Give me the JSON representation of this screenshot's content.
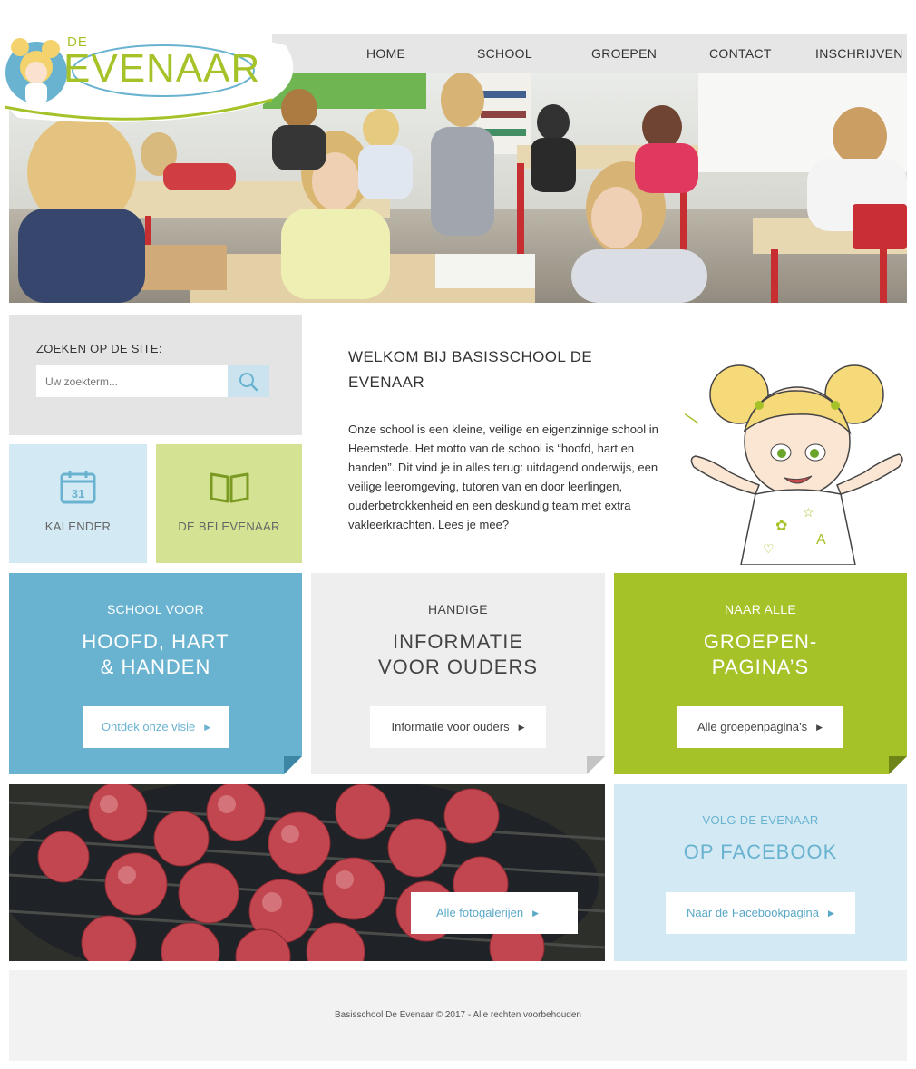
{
  "brand": {
    "logo_small": "DE",
    "logo_big": "EVENAAR"
  },
  "nav": {
    "items": [
      {
        "label": "HOME"
      },
      {
        "label": "SCHOOL"
      },
      {
        "label": "GROEPEN"
      },
      {
        "label": "CONTACT"
      },
      {
        "label": "INSCHRIJVEN"
      }
    ]
  },
  "search": {
    "label": "ZOEKEN OP DE SITE:",
    "placeholder": "Uw zoekterm..."
  },
  "tiles": {
    "calendar": {
      "label": "KALENDER",
      "icon": "calendar-icon",
      "day": "31"
    },
    "belevenaar": {
      "label": "DE BELEVENAAR",
      "icon": "open-book-icon"
    }
  },
  "welcome": {
    "title": "WELKOM BIJ BASISSCHOOL DE EVENAAR",
    "text": "Onze school is een kleine, veilige en eigenzinnige school in Heemstede. Het motto van de school is “hoofd, hart en handen”. Dit vind je in alles terug: uitdagend onderwijs, een veilige leeromgeving, tutoren van en door leerlingen, ouderbetrokkenheid en een deskundig team met extra vakleerkrachten. Lees je mee?"
  },
  "features": {
    "vision": {
      "sub": "SCHOOL VOOR",
      "title": "HOOFD, HART\n& HANDEN",
      "button": "Ontdek onze visie"
    },
    "parents": {
      "sub": "HANDIGE",
      "title": "INFORMATIE\nVOOR OUDERS",
      "button": "Informatie voor ouders"
    },
    "groups": {
      "sub": "NAAR ALLE",
      "title": "GROEPEN-\nPAGINA’S",
      "button": "Alle groepenpagina’s"
    }
  },
  "gallery": {
    "button": "Alle fotogalerijen"
  },
  "facebook": {
    "sub": "VOLG DE EVENAAR",
    "title": "OP FACEBOOK",
    "button": "Naar de Facebookpagina"
  },
  "footer": {
    "text": "Basisschool De Evenaar © 2017 - Alle rechten voorbehouden"
  },
  "colors": {
    "blue": "#69b3d1",
    "green": "#a6c229",
    "light_blue": "#d3e9f3",
    "light_green": "#d4e293",
    "grey": "#eeeeee"
  }
}
